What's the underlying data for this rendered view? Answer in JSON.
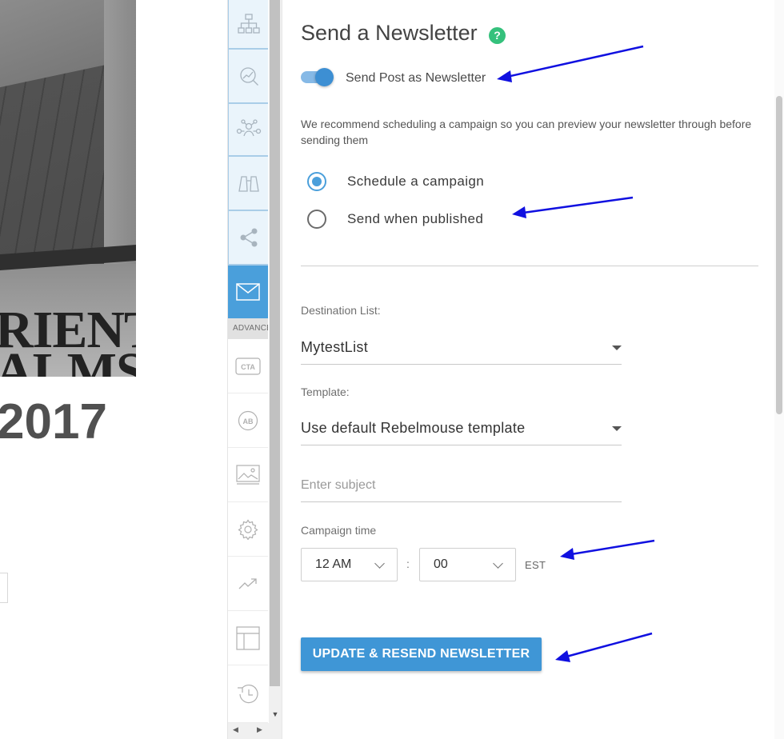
{
  "preview": {
    "hero_line1": "RIENT",
    "hero_line2": "ALMS",
    "year": "2017"
  },
  "rail": {
    "items": [
      {
        "icon": "sitemap-icon"
      },
      {
        "icon": "search-chart-icon"
      },
      {
        "icon": "network-icon"
      },
      {
        "icon": "binoculars-icon"
      },
      {
        "icon": "share-icon"
      },
      {
        "icon": "envelope-icon"
      },
      {
        "icon": "cta-icon",
        "text": "CTA"
      },
      {
        "icon": "ab-test-icon",
        "text": "AB"
      },
      {
        "icon": "image-icon"
      },
      {
        "icon": "gear-icon"
      },
      {
        "icon": "trending-icon"
      },
      {
        "icon": "layout-icon"
      },
      {
        "icon": "history-icon"
      }
    ],
    "advanced_label": "ADVANCED"
  },
  "panel": {
    "title": "Send a Newsletter",
    "help_glyph": "?",
    "toggle": {
      "label": "Send Post as Newsletter",
      "checked": true
    },
    "recommend_text": "We recommend scheduling a campaign so you can preview your newsletter through before sending them",
    "schedule_options": [
      {
        "label": "Schedule a campaign",
        "checked": true
      },
      {
        "label": "Send when published",
        "checked": false
      }
    ],
    "destination": {
      "label": "Destination List:",
      "value": "MytestList"
    },
    "template": {
      "label": "Template:",
      "value": "Use default Rebelmouse template"
    },
    "subject": {
      "value": "",
      "placeholder": "Enter subject"
    },
    "campaign_time": {
      "label": "Campaign time",
      "hour": "12 AM",
      "separator": ":",
      "minute": "00",
      "timezone": "EST"
    },
    "submit_label": "UPDATE & RESEND NEWSLETTER"
  },
  "colors": {
    "accent": "#4a9fdb",
    "help": "#35c17c",
    "annotation_arrow": "#1010e0"
  }
}
